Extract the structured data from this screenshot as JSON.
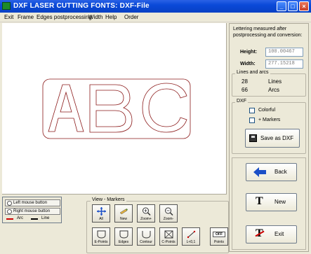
{
  "window": {
    "title": "DXF LASER CUTTING FONTS:  DXF-File"
  },
  "menu": {
    "items": [
      "Exit",
      "Frame",
      "Edges postprocessing",
      "Width",
      "Help",
      "Order"
    ]
  },
  "canvas": {
    "text": "ABC",
    "outline_color": "#8b1a1a",
    "frame_color": "#8b1a1a"
  },
  "measure": {
    "info": "Lettering measured after postprocessing and conversion:",
    "height_label": "Height:",
    "height_value": "100.00467",
    "width_label": "Width:",
    "width_value": "277.15218"
  },
  "lines_arcs": {
    "title": "Lines and arcs",
    "lines_count": "28",
    "lines_label": "Lines",
    "arcs_count": "66",
    "arcs_label": "Arcs"
  },
  "dxf": {
    "title": "DXF",
    "colorful_label": "Colorful",
    "markers_label": "+ Markers",
    "save_label": "Save as DXF"
  },
  "actions": {
    "back_label": "Back",
    "new_label": "New",
    "exit_label": "Exit"
  },
  "legend": {
    "left_mouse": "Left mouse button",
    "right_mouse": "Right mouse button",
    "arc_label": "Arc",
    "line_label": "Line",
    "arc_color": "#cc0000",
    "line_color": "#000000"
  },
  "view": {
    "title": "View - Markers",
    "buttons_row1": [
      "All",
      "New",
      "Zoom+",
      "Zoom-"
    ],
    "buttons_row2": [
      "E-Points",
      "Edges",
      "Contour",
      "C-Points",
      "L<0,1",
      "Points"
    ],
    "points_badge": "OFF"
  },
  "colors": {
    "titlebar": "#0a49d8",
    "back_arrow": "#1b4fc7"
  }
}
